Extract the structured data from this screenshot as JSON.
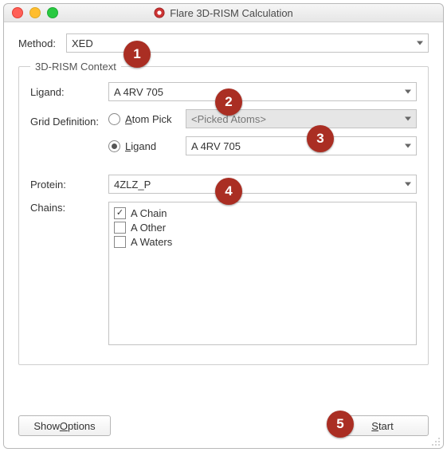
{
  "window": {
    "title": "Flare 3D-RISM Calculation",
    "icon_name": "flare-app-icon"
  },
  "method": {
    "label": "Method:",
    "value": "XED"
  },
  "context": {
    "legend": "3D-RISM Context",
    "ligand": {
      "label": "Ligand:",
      "value": "A 4RV 705"
    },
    "grid_def": {
      "label": "Grid Definition:",
      "options": {
        "atom_pick": {
          "label_pre": "A",
          "label_ul": "tom Pick",
          "checked": false,
          "combo_value": "<Picked Atoms>"
        },
        "ligand": {
          "label_ul": "L",
          "label_post": "igand",
          "checked": true,
          "combo_value": "A 4RV 705"
        }
      }
    },
    "protein": {
      "label": "Protein:",
      "value": "4ZLZ_P"
    },
    "chains": {
      "label": "Chains:",
      "items": [
        {
          "label": "A Chain",
          "checked": true
        },
        {
          "label": "A Other",
          "checked": false
        },
        {
          "label": "A Waters",
          "checked": false
        }
      ]
    }
  },
  "footer": {
    "show_options": {
      "pre": "Show ",
      "ul": "O",
      "post": "ptions"
    },
    "start": {
      "ul": "S",
      "post": "tart"
    }
  },
  "callouts": [
    "1",
    "2",
    "3",
    "4",
    "5"
  ],
  "colors": {
    "callout_bg": "#aa2e23"
  }
}
